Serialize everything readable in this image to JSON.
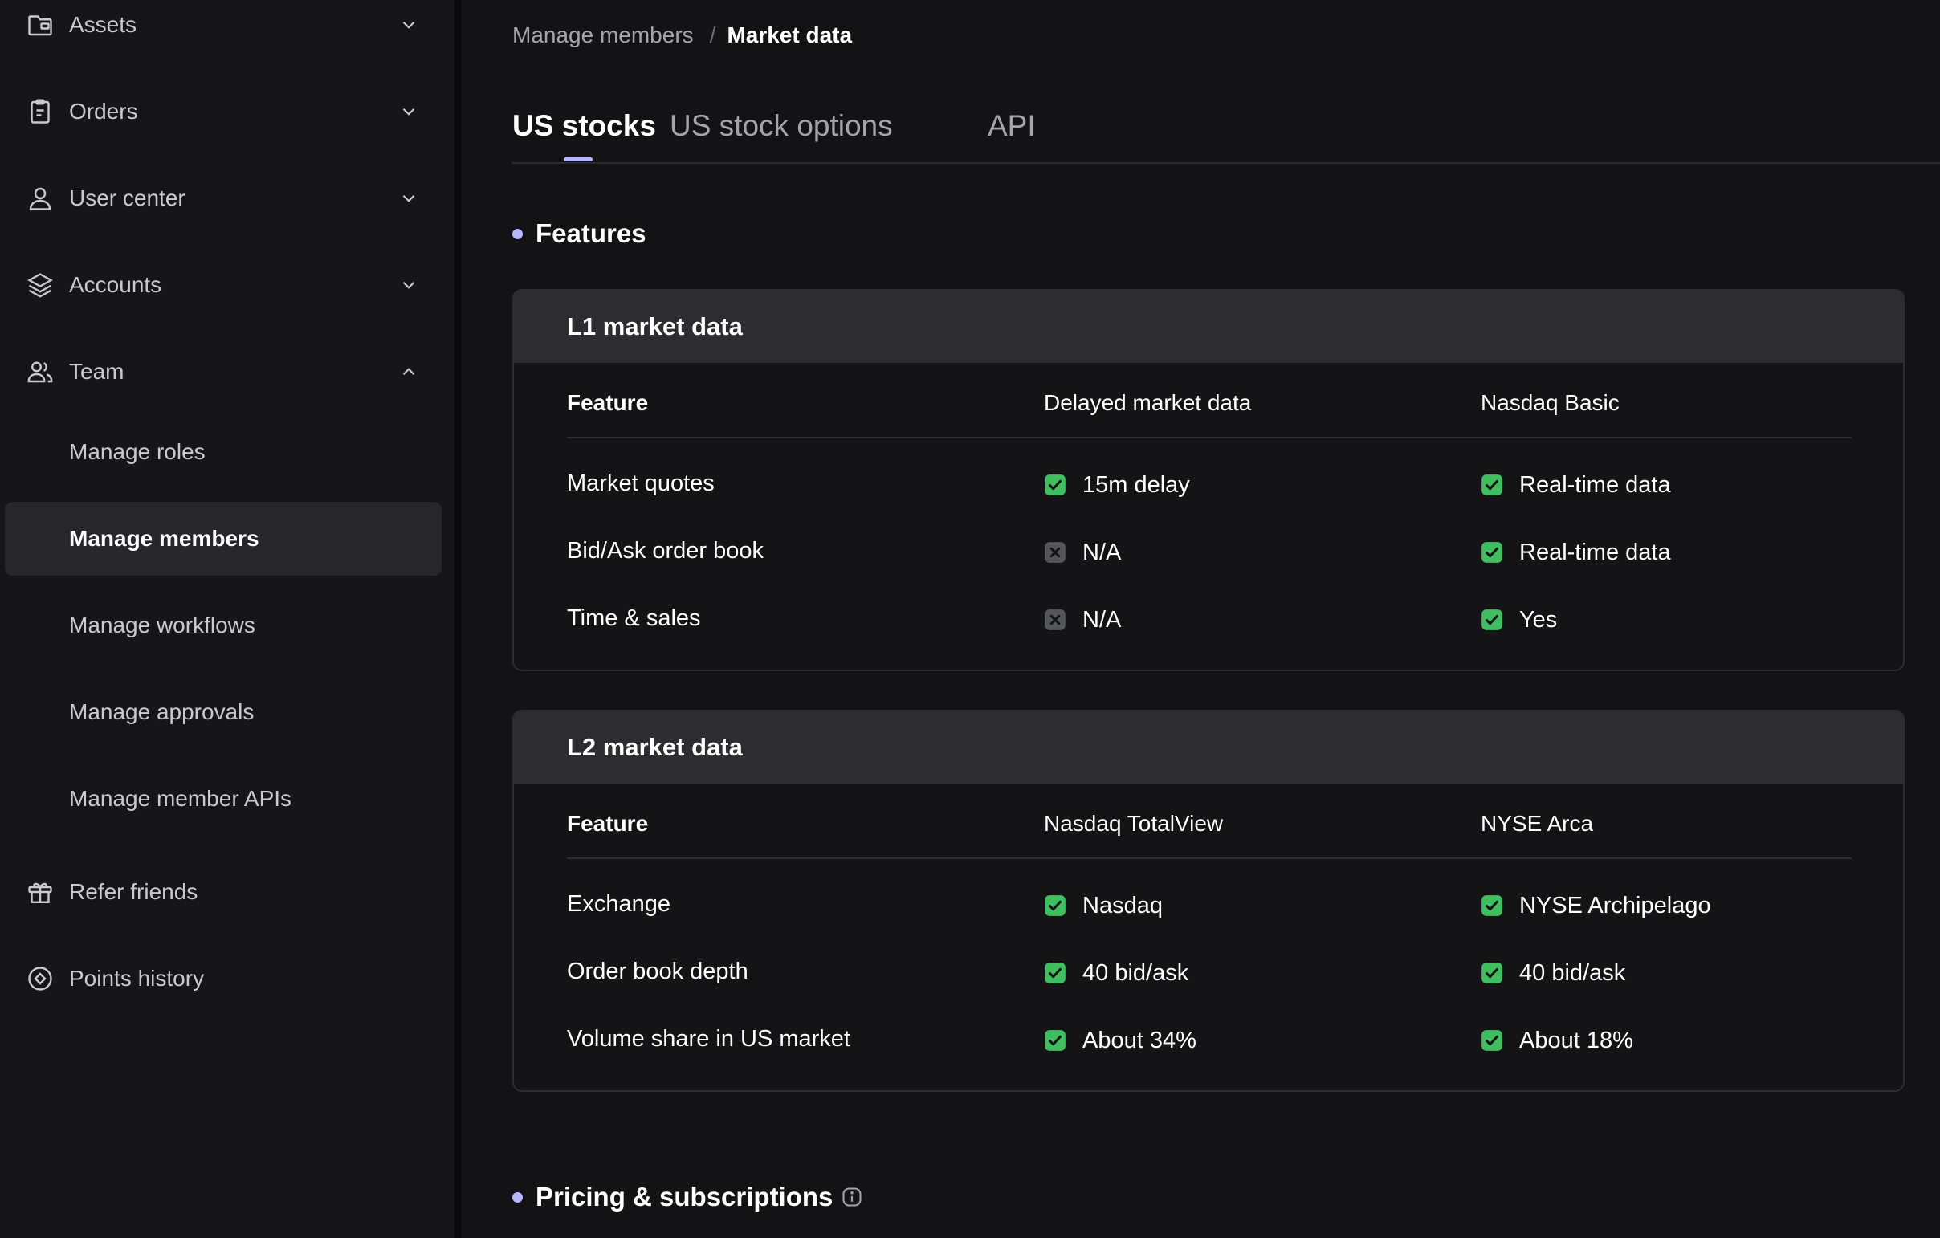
{
  "sidebar": {
    "nav": [
      {
        "label": "Assets",
        "icon": "folder-icon",
        "expanded": false
      },
      {
        "label": "Orders",
        "icon": "clipboard-icon",
        "expanded": false
      },
      {
        "label": "User center",
        "icon": "user-icon",
        "expanded": false
      },
      {
        "label": "Accounts",
        "icon": "layers-icon",
        "expanded": false
      },
      {
        "label": "Team",
        "icon": "team-icon",
        "expanded": true
      }
    ],
    "team_sub": [
      {
        "label": "Manage roles"
      },
      {
        "label": "Manage members",
        "active": true
      },
      {
        "label": "Manage workflows"
      },
      {
        "label": "Manage approvals"
      },
      {
        "label": "Manage member APIs"
      }
    ],
    "extra": [
      {
        "label": "Refer friends",
        "icon": "gift-icon"
      },
      {
        "label": "Points history",
        "icon": "points-icon"
      }
    ]
  },
  "breadcrumb": {
    "parent": "Manage members",
    "separator": "/",
    "current": "Market data"
  },
  "tabs": [
    {
      "label": "US stocks",
      "active": true
    },
    {
      "label": "US stock options"
    },
    {
      "label": "API"
    }
  ],
  "features": {
    "title": "Features",
    "tables": [
      {
        "title": "L1 market data",
        "columns": [
          "Feature",
          "Delayed market data",
          "Nasdaq Basic"
        ],
        "rows": [
          {
            "label": "Market quotes",
            "cells": [
              {
                "text": "15m delay",
                "status": "check"
              },
              {
                "text": "Real-time data",
                "status": "check"
              }
            ]
          },
          {
            "label": "Bid/Ask order book",
            "cells": [
              {
                "text": "N/A",
                "status": "cross"
              },
              {
                "text": "Real-time data",
                "status": "check"
              }
            ]
          },
          {
            "label": "Time & sales",
            "cells": [
              {
                "text": "N/A",
                "status": "cross"
              },
              {
                "text": "Yes",
                "status": "check"
              }
            ]
          }
        ]
      },
      {
        "title": "L2 market data",
        "columns": [
          "Feature",
          "Nasdaq TotalView",
          "NYSE Arca"
        ],
        "rows": [
          {
            "label": "Exchange",
            "cells": [
              {
                "text": "Nasdaq",
                "status": "check"
              },
              {
                "text": "NYSE Archipelago",
                "status": "check"
              }
            ]
          },
          {
            "label": "Order book depth",
            "cells": [
              {
                "text": "40 bid/ask",
                "status": "check"
              },
              {
                "text": "40 bid/ask",
                "status": "check"
              }
            ]
          },
          {
            "label": "Volume share in US market",
            "cells": [
              {
                "text": "About 34%",
                "status": "check"
              },
              {
                "text": "About 18%",
                "status": "check"
              }
            ]
          }
        ]
      }
    ]
  },
  "pricing": {
    "title": "Pricing & subscriptions",
    "icon": "info-icon"
  },
  "colors": {
    "accent": "#b4b7ff",
    "check": "#3fbf5f",
    "cross": "#55555c"
  }
}
